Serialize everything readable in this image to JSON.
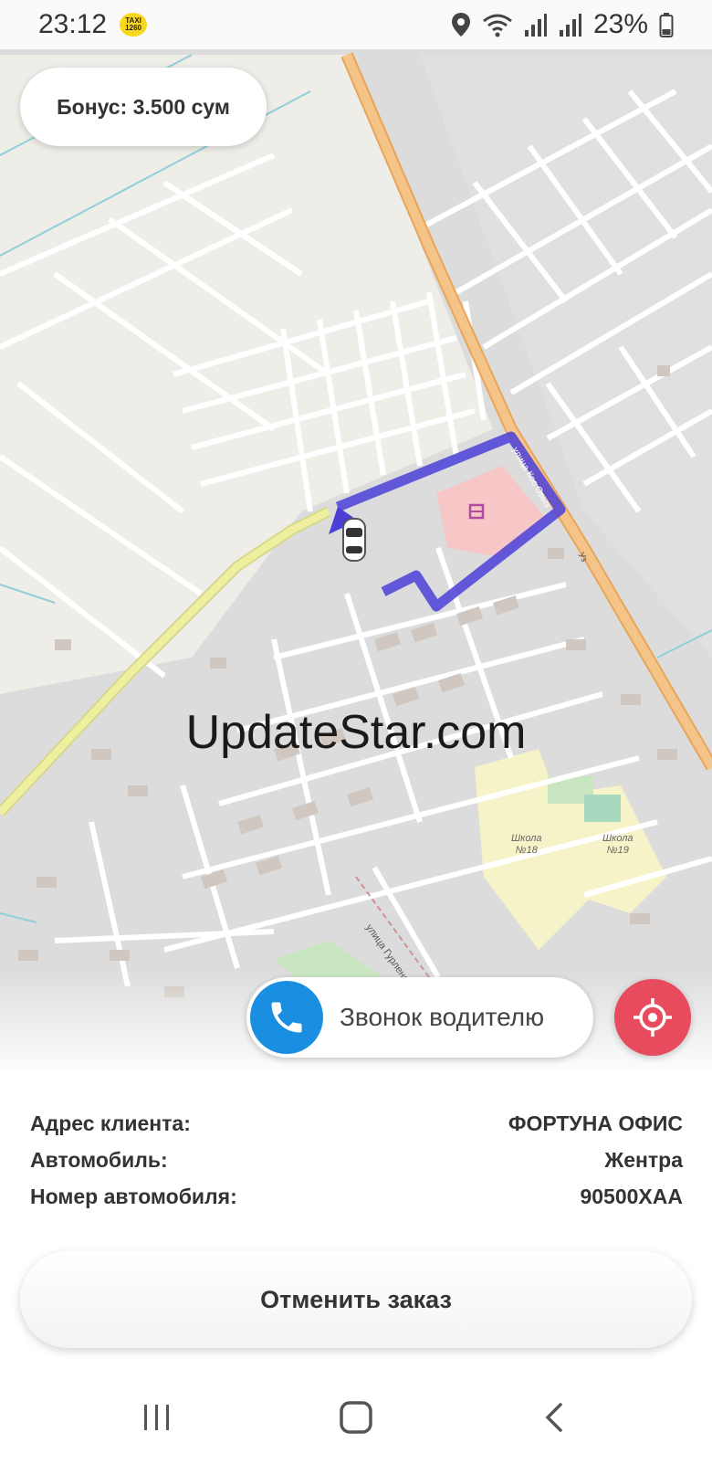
{
  "status_bar": {
    "time": "23:12",
    "app_badge_line1": "TAXI",
    "app_badge_line2": "1260",
    "battery": "23%"
  },
  "map": {
    "bonus_label": "Бонус: 3.500 сум",
    "watermark": "UpdateStar.com",
    "labels": {
      "school_18_a": "Школа",
      "school_18_b": "№18",
      "school_19_a": "Школа",
      "school_19_b": "№19",
      "street_1": "улица Гурленская",
      "street_2": "улица Кос Овыз",
      "street_3": "Уз"
    }
  },
  "call_driver": {
    "label": "Звонок водителю"
  },
  "order_info": {
    "rows": [
      {
        "label": "Адрес клиента:",
        "value": "ФОРТУНА ОФИС"
      },
      {
        "label": "Автомобиль:",
        "value": "Жентра"
      },
      {
        "label": "Номер автомобиля:",
        "value": "90500ХАА"
      }
    ]
  },
  "cancel_button": {
    "label": "Отменить заказ"
  },
  "colors": {
    "route": "#4b3fd8",
    "call_blue": "#1a8ee0",
    "locate_red": "#e84b5d",
    "main_road": "#f2b66a",
    "secondary_road": "#eef0a0"
  }
}
